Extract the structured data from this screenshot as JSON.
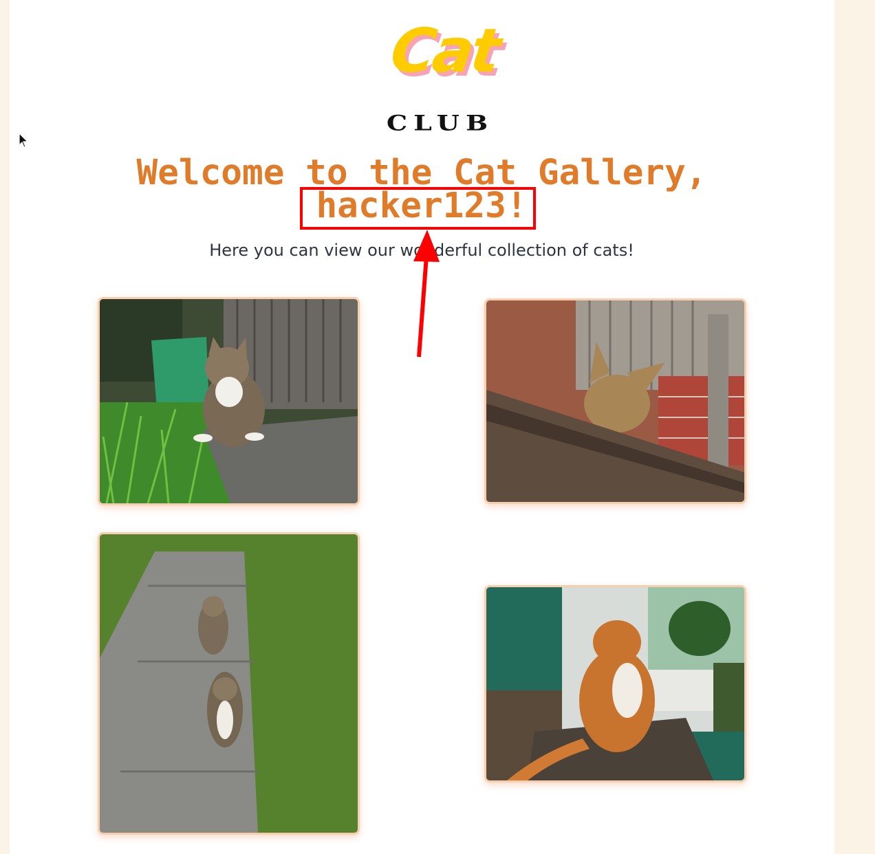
{
  "logo": {
    "line1": "Cat",
    "line2": "CLUB"
  },
  "heading": {
    "line1": "Welcome to the Cat Gallery,",
    "username": "hacker123!"
  },
  "subtitle": "Here you can view our wonderful collection of cats!",
  "colors": {
    "accent": "#e07b2a",
    "photo_border": "#f8cfae",
    "annotation": "#ff0000",
    "page_bg": "#fbf3e5"
  },
  "icons": {
    "cursor": "mouse-pointer-icon"
  },
  "gallery": [
    {
      "description": "tabby-cat-on-garden-step"
    },
    {
      "description": "tabby-cat-on-wooden-bench"
    },
    {
      "description": "two-cats-on-garden-path"
    },
    {
      "description": "ginger-cat-on-windowsill"
    }
  ]
}
